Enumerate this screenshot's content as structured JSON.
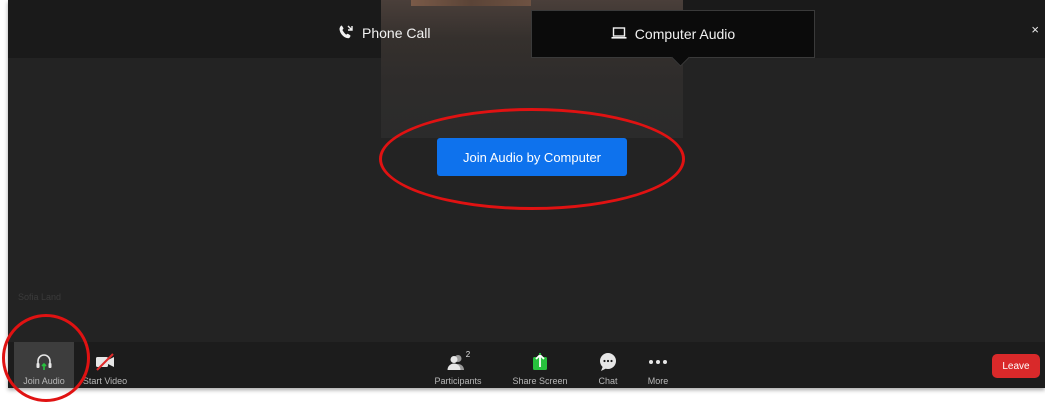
{
  "audio_tabs": {
    "phone_call": "Phone Call",
    "computer_audio": "Computer Audio",
    "close": "×"
  },
  "main": {
    "join_button_label": "Join Audio by Computer",
    "participant_name": "Sofia Land"
  },
  "toolbar": {
    "join_audio": "Join Audio",
    "start_video": "Start Video",
    "participants": "Participants",
    "participants_count": "2",
    "share_screen": "Share Screen",
    "chat": "Chat",
    "more": "More",
    "leave": "Leave"
  },
  "icons": {
    "phone": "phone-icon",
    "laptop": "laptop-icon",
    "headphones": "headphones-icon",
    "video_off": "video-off-icon",
    "participants": "participants-icon",
    "share": "share-screen-icon",
    "chat": "chat-icon",
    "more": "more-icon"
  },
  "colors": {
    "background": "#232323",
    "toolbar": "#1c1c1c",
    "accent_blue": "#0e72ed",
    "leave_red": "#d9292a",
    "share_green": "#27c23d",
    "annotation_red": "#e01212"
  }
}
